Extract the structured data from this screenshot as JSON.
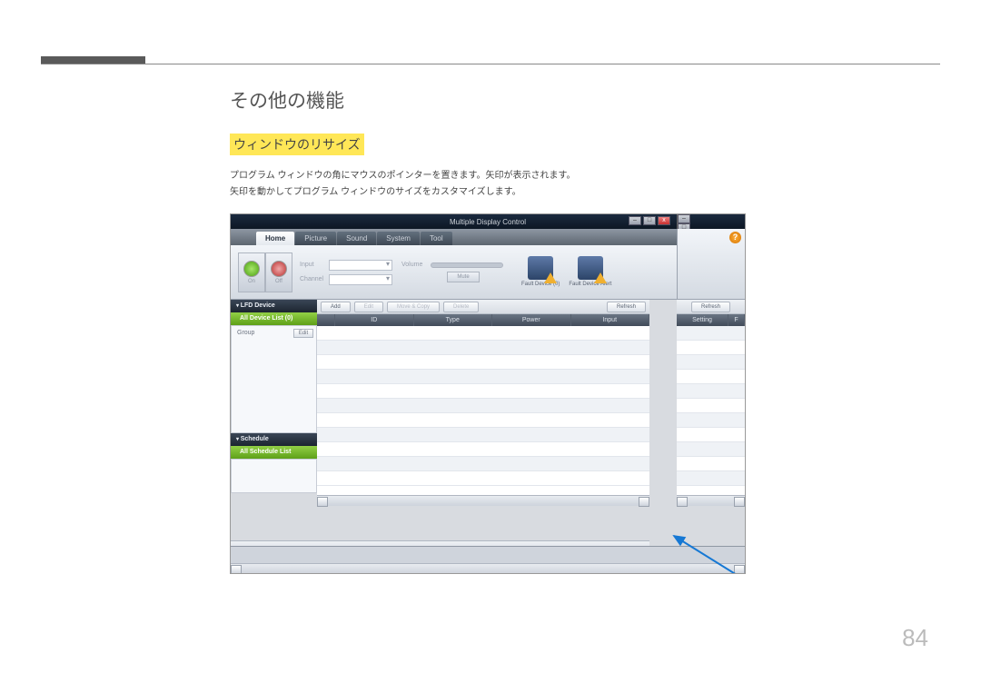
{
  "doc": {
    "heading": "その他の機能",
    "subheading": "ウィンドウのリサイズ",
    "para1": "プログラム ウィンドウの角にマウスのポインターを置きます。矢印が表示されます。",
    "para2": "矢印を動かしてプログラム ウィンドウのサイズをカスタマイズします。",
    "page_number": "84"
  },
  "app": {
    "title": "Multiple Display Control",
    "tabs": [
      "Home",
      "Picture",
      "Sound",
      "System",
      "Tool"
    ],
    "ribbon": {
      "power_on": "On",
      "power_off": "Off",
      "input_label": "Input",
      "channel_label": "Channel",
      "volume_label": "Volume",
      "mute": "Mute",
      "fault_device": "Fault Device (0)",
      "fault_alert": "Fault Device Alert"
    },
    "sidebar": {
      "lfd_header": "LFD Device",
      "all_device": "All Device List (0)",
      "group_label": "Group",
      "edit": "Edit",
      "schedule_header": "Schedule",
      "all_schedule": "All Schedule List"
    },
    "toolbar": {
      "add": "Add",
      "edit": "Edit",
      "move_copy": "Move & Copy",
      "delete": "Delete",
      "refresh": "Refresh"
    },
    "grid_headers": [
      "ID",
      "Type",
      "Power",
      "Input"
    ],
    "right_headers": [
      "Setting",
      "F"
    ],
    "window_buttons": {
      "min": "–",
      "max": "□",
      "close": "x"
    }
  }
}
